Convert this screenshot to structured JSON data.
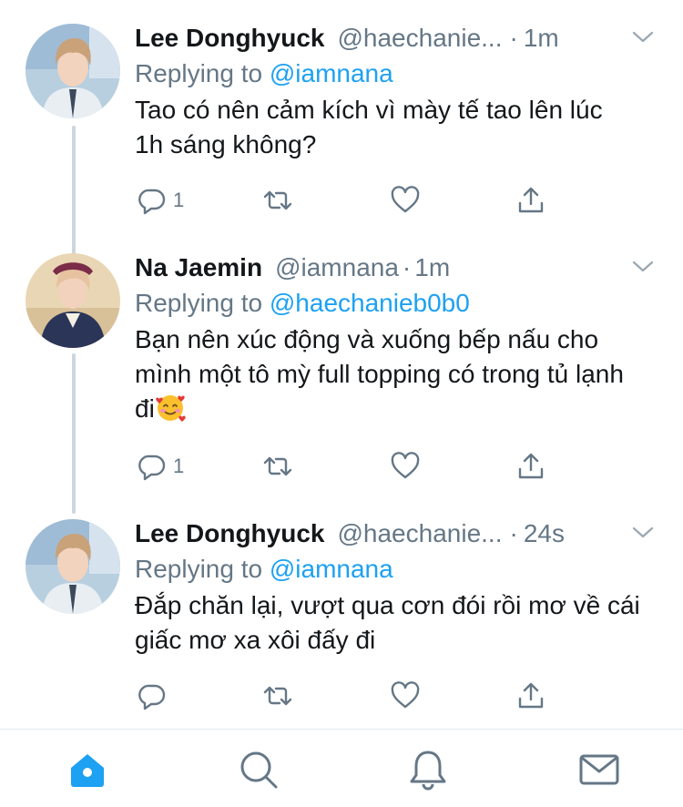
{
  "tweets": [
    {
      "name": "Lee Donghyuck",
      "handle": "@haechanie...",
      "time": "1m",
      "replying_label": "Replying to",
      "replying_to": "@iamnana",
      "text": "Tao có nên cảm kích vì mày tế tao lên lúc 1h sáng không?",
      "reply_count": "1",
      "avatar": "person-avatar-1"
    },
    {
      "name": "Na Jaemin",
      "handle": "@iamnana",
      "time": "1m",
      "replying_label": "Replying to",
      "replying_to": "@haechanieb0b0",
      "text": "Bạn nên xúc động và xuống bếp nấu cho mình một tô mỳ full topping có trong tủ lạnh đi",
      "reply_count": "1",
      "avatar": "person-avatar-2"
    },
    {
      "name": "Lee Donghyuck",
      "handle": "@haechanie...",
      "time": "24s",
      "replying_label": "Replying to",
      "replying_to": "@iamnana",
      "text": "Đắp chăn lại, vượt qua cơn đói rồi mơ về cái giấc mơ xa xôi đấy đi",
      "reply_count": "",
      "avatar": "person-avatar-1"
    }
  ],
  "separator": "·",
  "icons": {
    "reply": "reply-icon",
    "retweet": "retweet-icon",
    "like": "heart-icon",
    "share": "share-icon",
    "more": "chevron-down-icon",
    "emoji": "smiling-face-with-hearts-emoji"
  },
  "tabbar": [
    "home-icon",
    "search-icon",
    "notifications-icon",
    "messages-icon"
  ],
  "colors": {
    "accent": "#1da1f2",
    "secondary_text": "#657786",
    "thread_line": "#ccd6dd"
  }
}
